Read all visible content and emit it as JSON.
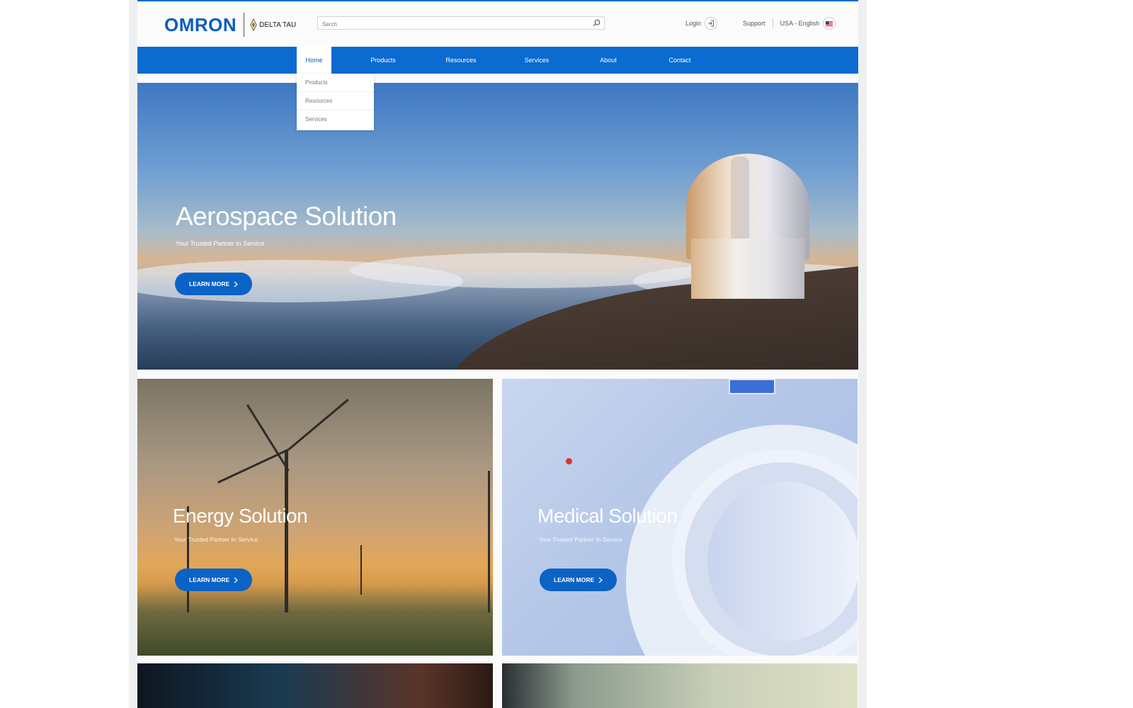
{
  "header": {
    "logo": "OMRON",
    "sub_brand": "DELTA TAU",
    "search_placeholder": "Serch",
    "login_label": "Login",
    "support_label": "Support",
    "locale_label": "USA - English"
  },
  "nav": {
    "items": [
      "Home",
      "Products",
      "Resources",
      "Services",
      "About",
      "Contact"
    ],
    "active": "Home",
    "dropdown": [
      "Products",
      "Resources",
      "Services"
    ]
  },
  "hero": {
    "title": "Aerospace Solution",
    "subtitle": "Your Trusted Partner In Service",
    "button": "LEARN MORE"
  },
  "cards": [
    {
      "title": "Energy Solution",
      "subtitle": "Your Trusted Partner In Service",
      "button": "LEARN MORE"
    },
    {
      "title": "Medical Solution",
      "subtitle": "Your Trusted Partner In Service",
      "button": "LEARN MORE"
    }
  ],
  "colors": {
    "brand": "#0b6bd0",
    "button": "#0b63c6"
  }
}
